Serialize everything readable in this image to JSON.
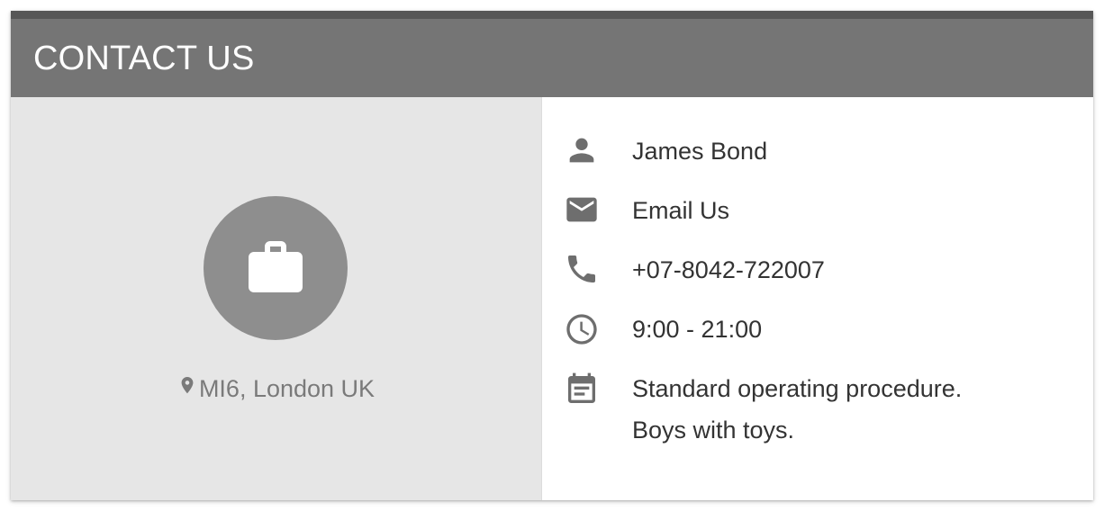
{
  "header": {
    "title": "CONTACT US"
  },
  "profile": {
    "avatar_icon": "briefcase-icon",
    "location_icon": "map-pin-icon",
    "location": "MI6, London UK"
  },
  "details": {
    "name": {
      "icon": "person-icon",
      "text": "James Bond"
    },
    "email": {
      "icon": "mail-icon",
      "text": "Email Us"
    },
    "phone": {
      "icon": "phone-icon",
      "text": "+07-8042-722007"
    },
    "hours": {
      "icon": "clock-icon",
      "text": "9:00 - 21:00"
    },
    "notes": {
      "icon": "calendar-note-icon",
      "line1": "Standard operating procedure.",
      "line2": "Boys with toys."
    }
  },
  "colors": {
    "header_bg": "#757575",
    "header_top_bar": "#575757",
    "left_pane_bg": "#e6e6e6",
    "avatar_bg": "#8e8e8e",
    "icon_color": "#6e6e6e",
    "text_color": "#333333"
  }
}
